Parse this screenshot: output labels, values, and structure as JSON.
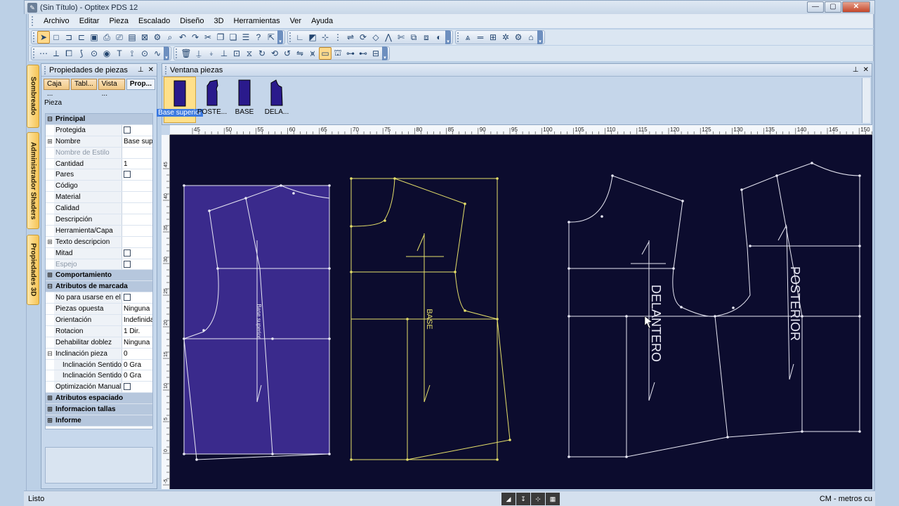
{
  "window": {
    "title": "(Sin Título) - Optitex PDS 12",
    "app_icon": "optitex-logo-icon"
  },
  "menu": [
    "Archivo",
    "Editar",
    "Pieza",
    "Escalado",
    "Diseño",
    "3D",
    "Herramientas",
    "Ver",
    "Ayuda"
  ],
  "side_tabs": [
    "Sombreado",
    "Administrador Shaders",
    "Propiedades 3D"
  ],
  "properties_panel": {
    "title": "Propiedades de piezas",
    "tabs": [
      "Caja ...",
      "Tabl...",
      "Vista ...",
      "Prop..."
    ],
    "section_label": "Pieza",
    "rows": [
      {
        "type": "cat",
        "name": "Principal",
        "exp": "⊟"
      },
      {
        "name": "Protegida",
        "check": true
      },
      {
        "name": "Nombre",
        "value": "Base supe",
        "exp": "⊞"
      },
      {
        "name": "Nombre de Estilo",
        "dim": true,
        "value": ""
      },
      {
        "name": "Cantidad",
        "value": "1"
      },
      {
        "name": "Pares",
        "check": true
      },
      {
        "name": "Código",
        "value": ""
      },
      {
        "name": "Material",
        "value": ""
      },
      {
        "name": "Calidad",
        "value": ""
      },
      {
        "name": "Descripción",
        "value": ""
      },
      {
        "name": "Herramienta/Capa",
        "value": ""
      },
      {
        "name": "Texto descripcion",
        "value": "",
        "exp": "⊞"
      },
      {
        "name": "Mitad",
        "check": true
      },
      {
        "name": "Espejo",
        "check": true,
        "dim": true
      },
      {
        "type": "cat",
        "name": "Comportamiento",
        "exp": "⊞"
      },
      {
        "type": "cat",
        "name": "Atributos de marcada",
        "exp": "⊟"
      },
      {
        "name": "No para usarse en el r",
        "check": true
      },
      {
        "name": "Piezas opuesta",
        "value": "Ninguna"
      },
      {
        "name": "Orientación",
        "value": "Indefinida"
      },
      {
        "name": "Rotacion",
        "value": "1 Dir."
      },
      {
        "name": "Dehabilitar doblez",
        "value": "Ninguna"
      },
      {
        "name": "Inclinación pieza",
        "value": "0",
        "exp": "⊟"
      },
      {
        "name": "Inclinación Sentido",
        "value": "0 Gra",
        "indent": true
      },
      {
        "name": "Inclinación Sentido",
        "value": "0 Gra",
        "indent": true
      },
      {
        "name": "Optimización Manual",
        "check": true
      },
      {
        "type": "cat",
        "name": "Atributos espaciado",
        "exp": "⊞"
      },
      {
        "type": "cat",
        "name": "Informacion tallas",
        "exp": "⊞"
      },
      {
        "type": "cat",
        "name": "Informe",
        "exp": "⊞"
      }
    ]
  },
  "pieces_window": {
    "title": "Ventana piezas",
    "pieces": [
      {
        "label": "Base superior",
        "selected": true
      },
      {
        "label": "POSTE..."
      },
      {
        "label": "BASE"
      },
      {
        "label": "DELA..."
      }
    ]
  },
  "ruler_top": [
    "45",
    "50",
    "55",
    "60",
    "65",
    "70",
    "75",
    "80",
    "85",
    "90",
    "95",
    "100",
    "105",
    "110",
    "115",
    "120",
    "125",
    "130",
    "135",
    "140",
    "145",
    "150"
  ],
  "ruler_left": [
    "45",
    "40",
    "35",
    "30",
    "25",
    "20",
    "15",
    "10",
    "5",
    "0",
    "-5"
  ],
  "canvas_labels": {
    "base_superior": "Base superior",
    "base": "BASE",
    "delantero": "DELANTERO",
    "posterior": "POSTERIOR"
  },
  "colors": {
    "workspace": "#0c0c2e",
    "selected_fill": "#3a2a8c",
    "white_line": "#e8e8f4",
    "yellow_line": "#e6e06a"
  },
  "status": {
    "text": "Listo",
    "units": "CM - metros cu"
  }
}
